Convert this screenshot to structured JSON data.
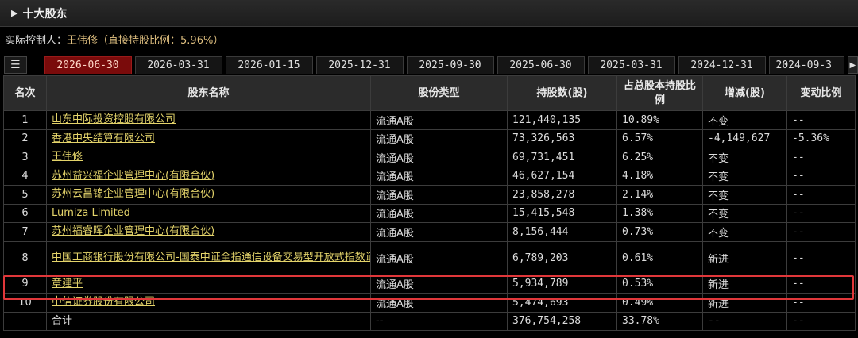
{
  "section": {
    "title": "十大股东"
  },
  "controller": {
    "label": "实际控制人：",
    "value": "王伟修（直接持股比例：5.96%）"
  },
  "tabs": {
    "menu_glyph": "☰",
    "items": [
      "2026-06-30",
      "2026-03-31",
      "2026-01-15",
      "2025-12-31",
      "2025-09-30",
      "2025-06-30",
      "2025-03-31",
      "2024-12-31"
    ],
    "active_index": 0,
    "overflow": "2024-09-3",
    "scroll_glyph": "▶"
  },
  "table": {
    "headers": [
      "名次",
      "股东名称",
      "股份类型",
      "持股数(股)",
      "占总股本持股比例",
      "增减(股)",
      "变动比例"
    ],
    "rows": [
      {
        "rank": "1",
        "name": "山东中际投资控股有限公司",
        "type": "流通A股",
        "shares": "121,440,135",
        "pct": "10.89%",
        "change": "不变",
        "change_ratio": "--"
      },
      {
        "rank": "2",
        "name": "香港中央结算有限公司",
        "type": "流通A股",
        "shares": "73,326,563",
        "pct": "6.57%",
        "change": "-4,149,627",
        "change_ratio": "-5.36%"
      },
      {
        "rank": "3",
        "name": "王伟修",
        "type": "流通A股",
        "shares": "69,731,451",
        "pct": "6.25%",
        "change": "不变",
        "change_ratio": "--"
      },
      {
        "rank": "4",
        "name": "苏州益兴福企业管理中心(有限合伙)",
        "type": "流通A股",
        "shares": "46,627,154",
        "pct": "4.18%",
        "change": "不变",
        "change_ratio": "--"
      },
      {
        "rank": "5",
        "name": "苏州云昌锦企业管理中心(有限合伙)",
        "type": "流通A股",
        "shares": "23,858,278",
        "pct": "2.14%",
        "change": "不变",
        "change_ratio": "--"
      },
      {
        "rank": "6",
        "name": "Lumiza Limited",
        "type": "流通A股",
        "shares": "15,415,548",
        "pct": "1.38%",
        "change": "不变",
        "change_ratio": "--"
      },
      {
        "rank": "7",
        "name": "苏州福睿晖企业管理中心(有限合伙)",
        "type": "流通A股",
        "shares": "8,156,444",
        "pct": "0.73%",
        "change": "不变",
        "change_ratio": "--"
      },
      {
        "rank": "8",
        "name": "中国工商银行股份有限公司-国泰中证全指通信设备交易型开放式指数证券投资基金",
        "type": "流通A股",
        "shares": "6,789,203",
        "pct": "0.61%",
        "change": "新进",
        "change_ratio": "--"
      },
      {
        "rank": "9",
        "name": "章建平",
        "type": "流通A股",
        "shares": "5,934,789",
        "pct": "0.53%",
        "change": "新进",
        "change_ratio": "--"
      },
      {
        "rank": "10",
        "name": "中信证券股份有限公司",
        "type": "流通A股",
        "shares": "5,474,693",
        "pct": "0.49%",
        "change": "新进",
        "change_ratio": "--"
      }
    ],
    "total": {
      "rank": "",
      "name": "合计",
      "type": "--",
      "shares": "376,754,258",
      "pct": "33.78%",
      "change": "--",
      "change_ratio": "--"
    }
  },
  "colors": {
    "active_tab": "#7a0b0b",
    "link": "#e3d36a",
    "negative": "#19c719",
    "new_entry": "#ff3b3b",
    "highlight_border": "#e1373a"
  }
}
